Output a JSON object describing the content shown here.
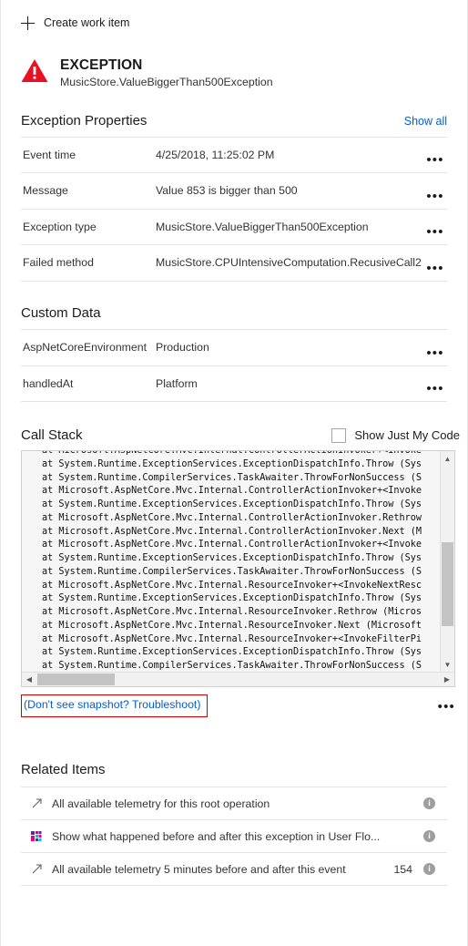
{
  "command_bar": {
    "create_work_item_label": "Create work item",
    "plus_icon": "plus-icon"
  },
  "exception_header": {
    "icon": "error-triangle-icon",
    "title": "EXCEPTION",
    "subtitle": "MusicStore.ValueBiggerThan500Exception",
    "icon_color": "#e81123"
  },
  "exception_properties": {
    "section_title": "Exception Properties",
    "show_all_label": "Show all",
    "link_color": "#015cda",
    "ellipsis_label": "•••",
    "rows": [
      {
        "key": "Event time",
        "value": "4/25/2018, 11:25:02 PM"
      },
      {
        "key": "Message",
        "value": "Value 853 is bigger than 500"
      },
      {
        "key": "Exception type",
        "value": "MusicStore.ValueBiggerThan500Exception"
      },
      {
        "key": "Failed method",
        "value": "MusicStore.CPUIntensiveComputation.RecusiveCall2"
      }
    ]
  },
  "custom_data": {
    "section_title": "Custom Data",
    "rows": [
      {
        "key": "AspNetCoreEnvironment",
        "value": "Production"
      },
      {
        "key": "handledAt",
        "value": "Platform"
      }
    ]
  },
  "call_stack": {
    "section_title": "Call Stack",
    "show_just_my_code_label": "Show Just My Code",
    "show_just_my_code_checked": false,
    "lines": [
      "at Microsoft.AspNetCore.Mvc.Internal.ControllerActionInvoker+<Invoke",
      "at System.Runtime.ExceptionServices.ExceptionDispatchInfo.Throw (Sys",
      "at System.Runtime.CompilerServices.TaskAwaiter.ThrowForNonSuccess (S",
      "at Microsoft.AspNetCore.Mvc.Internal.ControllerActionInvoker+<Invoke",
      "at System.Runtime.ExceptionServices.ExceptionDispatchInfo.Throw (Sys",
      "at Microsoft.AspNetCore.Mvc.Internal.ControllerActionInvoker.Rethrow",
      "at Microsoft.AspNetCore.Mvc.Internal.ControllerActionInvoker.Next (M",
      "at Microsoft.AspNetCore.Mvc.Internal.ControllerActionInvoker+<Invoke",
      "at System.Runtime.ExceptionServices.ExceptionDispatchInfo.Throw (Sys",
      "at System.Runtime.CompilerServices.TaskAwaiter.ThrowForNonSuccess (S",
      "at Microsoft.AspNetCore.Mvc.Internal.ResourceInvoker+<InvokeNextResc",
      "at System.Runtime.ExceptionServices.ExceptionDispatchInfo.Throw (Sys",
      "at Microsoft.AspNetCore.Mvc.Internal.ResourceInvoker.Rethrow (Micros",
      "at Microsoft.AspNetCore.Mvc.Internal.ResourceInvoker.Next (Microsoft",
      "at Microsoft.AspNetCore.Mvc.Internal.ResourceInvoker+<InvokeFilterPi",
      "at System.Runtime.ExceptionServices.ExceptionDispatchInfo.Throw (Sys",
      "at System.Runtime.CompilerServices.TaskAwaiter.ThrowForNonSuccess (S"
    ],
    "scroll_up_icon": "scroll-up-arrow-icon",
    "scroll_down_icon": "scroll-down-arrow-icon",
    "scroll_left_icon": "scroll-left-arrow-icon",
    "scroll_right_icon": "scroll-right-arrow-icon"
  },
  "troubleshoot": {
    "label": "(Don't see snapshot? Troubleshoot)",
    "highlight_color": "#d40000",
    "ellipsis_label": "•••"
  },
  "related_items": {
    "section_title": "Related Items",
    "rows": [
      {
        "icon": "external-link-arrow-icon",
        "label": "All available telemetry for this root operation",
        "count": "",
        "info_icon": "info-icon"
      },
      {
        "icon": "user-flows-icon",
        "label": "Show what happened before and after this exception in User Flo...",
        "count": "",
        "info_icon": "info-icon"
      },
      {
        "icon": "external-link-arrow-icon",
        "label": "All available telemetry 5 minutes before and after this event",
        "count": "154",
        "info_icon": "info-icon"
      }
    ]
  }
}
